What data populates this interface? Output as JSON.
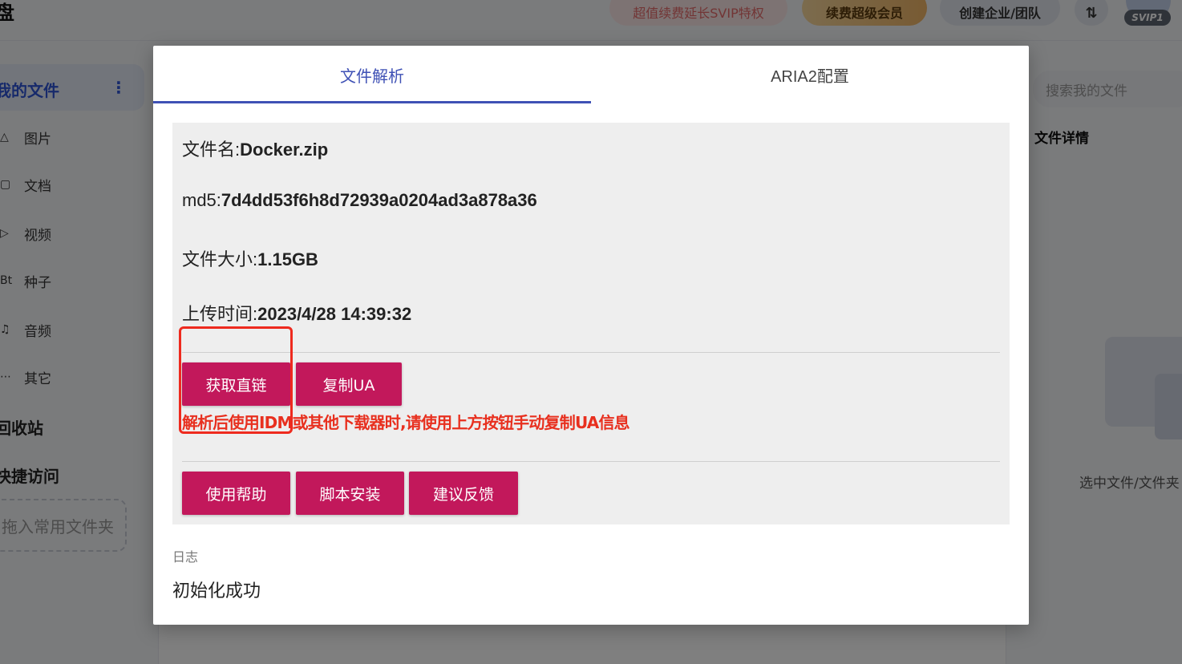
{
  "background": {
    "logo_text": "盘",
    "header": {
      "renew_pill": "超值续费延长SVIP特权",
      "super_member_pill": "续费超级会员",
      "enterprise_pill": "创建企业/团队",
      "transfer_icon": "⇅",
      "svip_badge": "SVIP1"
    },
    "sidebar": {
      "active_item": "我的文件",
      "more_icon": "⋮",
      "items": [
        {
          "icon": "△",
          "label": "图片"
        },
        {
          "icon": "▢",
          "label": "文档"
        },
        {
          "icon": "▷",
          "label": "视频"
        },
        {
          "icon": "Bt",
          "label": "种子"
        },
        {
          "icon": "♫",
          "label": "音频"
        },
        {
          "icon": "⋯",
          "label": "其它"
        }
      ],
      "recycle_bin": "回收站",
      "quick_access": "快捷访问",
      "add_folder_hint": "拖入常用文件夹"
    },
    "right_panel": {
      "search_placeholder": "搜索我的文件",
      "detail_title": "文件详情",
      "empty_hint": "选中文件/文件夹"
    }
  },
  "modal": {
    "tabs": [
      {
        "label": "文件解析",
        "active": true
      },
      {
        "label": "ARIA2配置",
        "active": false
      }
    ],
    "file_info": {
      "name_label": "文件名:",
      "name_value": "Docker.zip",
      "md5_label": "md5:",
      "md5_value": "7d4dd53f6h8d72939a0204ad3a878a36",
      "size_label": "文件大小:",
      "size_value": "1.15GB",
      "upload_label": "上传时间:",
      "upload_value": "2023/4/28 14:39:32"
    },
    "actions": {
      "get_link": "获取直链",
      "copy_ua": "复制UA"
    },
    "warning": "解析后使用IDM或其他下载器时,请使用上方按钮手动复制UA信息",
    "footer_buttons": {
      "help": "使用帮助",
      "install": "脚本安装",
      "feedback": "建议反馈"
    },
    "log": {
      "label": "日志",
      "message": "初始化成功"
    }
  },
  "colors": {
    "accent_tab": "#3f51b5",
    "button": "#c2185b",
    "warning": "#e8301f",
    "highlight_box": "#ee2a1e"
  }
}
